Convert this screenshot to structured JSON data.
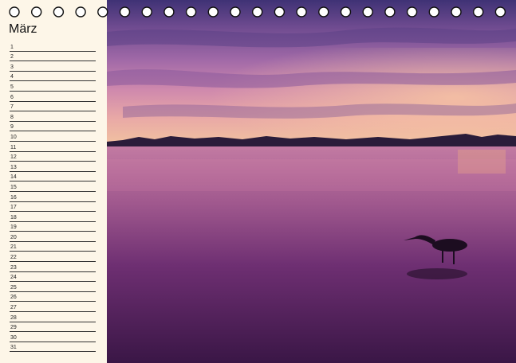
{
  "calendar": {
    "month": "März",
    "days": [
      "1",
      "2",
      "3",
      "4",
      "5",
      "6",
      "7",
      "8",
      "9",
      "10",
      "11",
      "12",
      "13",
      "14",
      "15",
      "16",
      "17",
      "18",
      "19",
      "20",
      "21",
      "22",
      "23",
      "24",
      "25",
      "26",
      "27",
      "28",
      "29",
      "30",
      "31"
    ]
  },
  "photo": {
    "icon": "sunset-heron-photo",
    "colors": {
      "sky_top": "#4a3a7a",
      "sky_mid": "#b06aa8",
      "horizon": "#e7a3a8",
      "water": "#7a3a78"
    }
  }
}
